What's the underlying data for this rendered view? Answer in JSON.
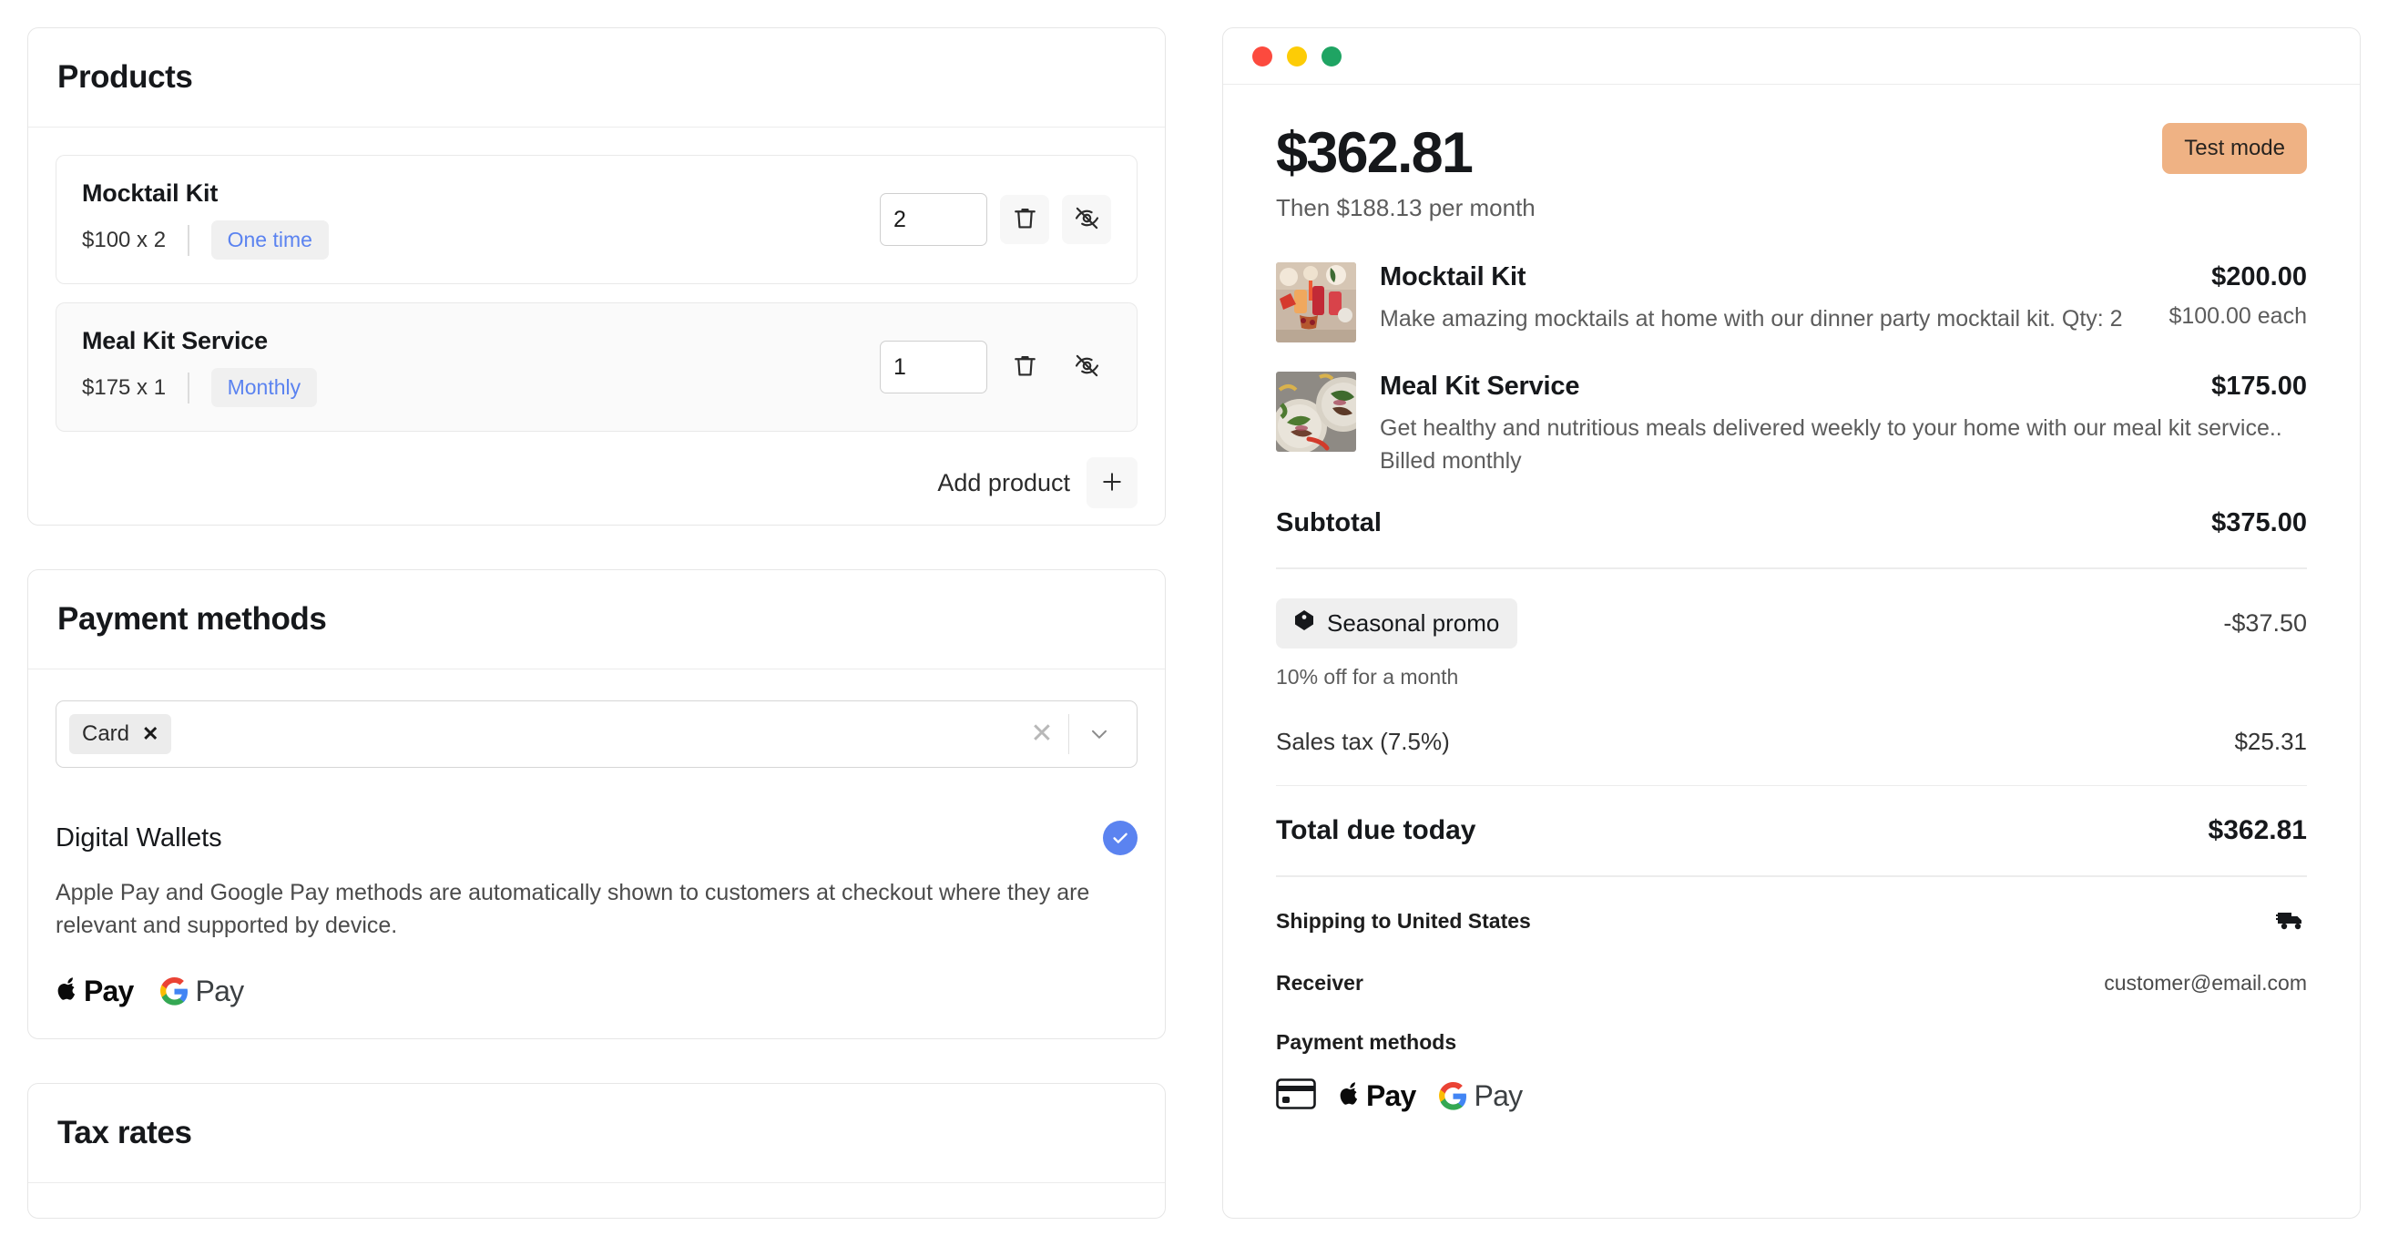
{
  "products_card": {
    "title": "Products",
    "rows": [
      {
        "name": "Mocktail Kit",
        "price_line": "$100 x 2",
        "badge": "One time",
        "qty": "2",
        "delete_icon": "trash-icon",
        "hide_icon": "eye-off-icon"
      },
      {
        "name": "Meal Kit Service",
        "price_line": "$175 x 1",
        "badge": "Monthly",
        "qty": "1",
        "delete_icon": "trash-icon",
        "hide_icon": "eye-off-icon"
      }
    ],
    "add_product_label": "Add product",
    "add_icon": "plus-icon"
  },
  "payment_card": {
    "title": "Payment methods",
    "select": {
      "tag": "Card",
      "remove_icon": "close-icon",
      "clear_icon": "clear-icon",
      "caret_icon": "chevron-down-icon"
    },
    "digital_wallets": {
      "title": "Digital Wallets",
      "enabled_icon": "check-circle-icon",
      "description": "Apple Pay and Google Pay methods are automatically shown to customers at checkout where they are relevant and supported by device.",
      "apple_pay_label": "Pay",
      "google_pay_label": "Pay"
    }
  },
  "tax_card": {
    "title": "Tax rates"
  },
  "preview": {
    "window_dots": [
      "#fc4a3e",
      "#fdcc06",
      "#1fa463"
    ],
    "amount": "$362.81",
    "then": "Then $188.13 per month",
    "test_mode": "Test mode",
    "line_items": [
      {
        "name": "Mocktail Kit",
        "amount": "$200.00",
        "description": "Make amazing mocktails at home with our dinner party mocktail kit. Qty: 2",
        "each": "$100.00 each",
        "thumb": "mocktail-photo"
      },
      {
        "name": "Meal Kit Service",
        "amount": "$175.00",
        "description": "Get healthy and nutritious meals delivered weekly to your home with our meal kit service.. Billed monthly",
        "each": "",
        "thumb": "mealkit-photo"
      }
    ],
    "subtotal_label": "Subtotal",
    "subtotal_value": "$375.00",
    "promo": {
      "label": "Seasonal promo",
      "icon": "tag-icon",
      "amount": "-$37.50",
      "sub": "10% off for a month"
    },
    "tax_label": "Sales tax (7.5%)",
    "tax_value": "$25.31",
    "total_label": "Total due today",
    "total_value": "$362.81",
    "shipping_label": "Shipping to United States",
    "shipping_icon": "truck-icon",
    "receiver_label": "Receiver",
    "receiver_value": "customer@email.com",
    "payment_methods_label": "Payment methods",
    "payment_icons": [
      "credit-card-icon",
      "apple-pay-icon",
      "google-pay-icon"
    ],
    "apple_pay_label": "Pay",
    "google_pay_label": "Pay"
  }
}
